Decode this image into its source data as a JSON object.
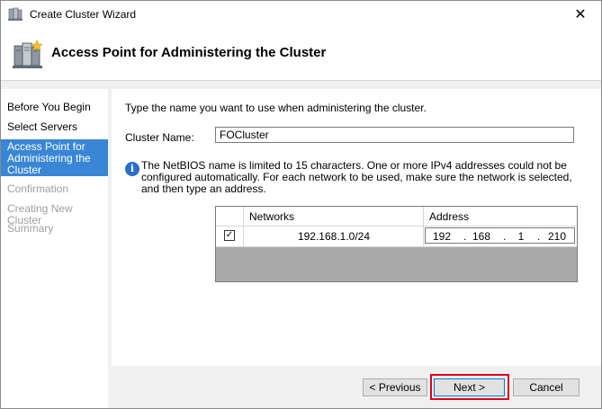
{
  "window": {
    "title": "Create Cluster Wizard",
    "close_glyph": "✕"
  },
  "header": {
    "title": "Access Point for Administering the Cluster",
    "icon": "cluster-servers-icon"
  },
  "sidebar": {
    "items": [
      {
        "label": "Before You Begin",
        "state": "normal"
      },
      {
        "label": "Select Servers",
        "state": "normal"
      },
      {
        "label": "Access Point for Administering the Cluster",
        "state": "active"
      },
      {
        "label": "Confirmation",
        "state": "disabled"
      },
      {
        "label": "Creating New Cluster",
        "state": "disabled"
      },
      {
        "label": "Summary",
        "state": "disabled"
      }
    ]
  },
  "content": {
    "intro": "Type the name you want to use when administering the cluster.",
    "cluster_name_label": "Cluster Name:",
    "cluster_name_value": "FOCluster",
    "info_text": "The NetBIOS name is limited to 15 characters.  One or more IPv4 addresses could not be configured automatically.  For each network to be used, make sure the network is selected, and then type an address.",
    "grid": {
      "columns": [
        "Networks",
        "Address"
      ],
      "rows": [
        {
          "checked": true,
          "check_glyph": "✓",
          "network": "192.168.1.0/24",
          "address": [
            "192",
            "168",
            "1",
            "210"
          ]
        }
      ]
    }
  },
  "buttons": {
    "previous": "< Previous",
    "next": "Next >",
    "cancel": "Cancel"
  },
  "colors": {
    "active_nav_bg": "#3a86d6",
    "highlight_border": "#e0001b",
    "info_icon": "#2a6fc9"
  }
}
